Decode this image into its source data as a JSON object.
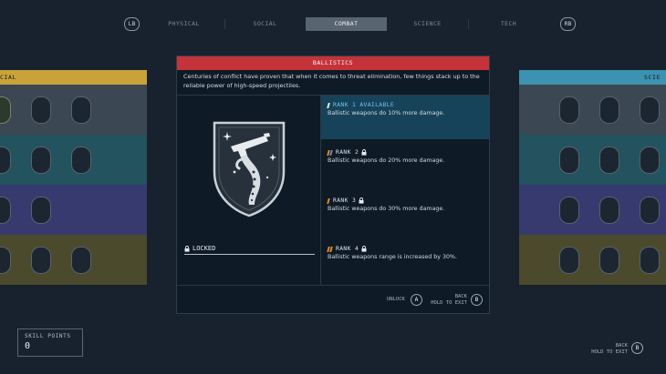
{
  "tabs": {
    "lb": "LB",
    "rb": "RB",
    "items": [
      {
        "label": "PHYSICAL"
      },
      {
        "label": "SOCIAL"
      },
      {
        "label": "COMBAT",
        "active": true
      },
      {
        "label": "SCIENCE"
      },
      {
        "label": "TECH"
      }
    ]
  },
  "columns": {
    "left_header": "CIAL",
    "left_header_color": "#c9a23a",
    "right_header": "SCIE",
    "right_header_color": "#3c92b0",
    "band_colors": [
      "#3b4753",
      "#23535e",
      "#373a6e",
      "#4c4a2c"
    ]
  },
  "popup": {
    "title": "BALLISTICS",
    "title_color": "#c5333a",
    "description": "Centuries of conflict have proven that when it comes to threat elimination, few things stack up to the reliable power of high-speed projectiles.",
    "badge_icon": "pistol-tentacle-badge-icon",
    "locked_label": "LOCKED",
    "ranks": [
      {
        "label": "RANK 1 AVAILABLE",
        "text": "Ballistic weapons do 10% more damage.",
        "selected": true
      },
      {
        "label": "RANK 2",
        "text": "Ballistic weapons do 20% more damage."
      },
      {
        "label": "RANK 3",
        "text": "Ballistic weapons do 30% more damage."
      },
      {
        "label": "RANK 4",
        "text": "Ballistic weapons range is increased by 30%."
      }
    ],
    "footer": {
      "unlock_label": "UNLOCK",
      "unlock_key": "A",
      "back_label": "BACK",
      "hold_label": "HOLD TO EXIT",
      "back_key": "B"
    }
  },
  "skill_points": {
    "label": "SKILL POINTS",
    "value": "0"
  },
  "global_back": {
    "back_label": "BACK",
    "hold_label": "HOLD TO EXIT",
    "key": "B"
  }
}
